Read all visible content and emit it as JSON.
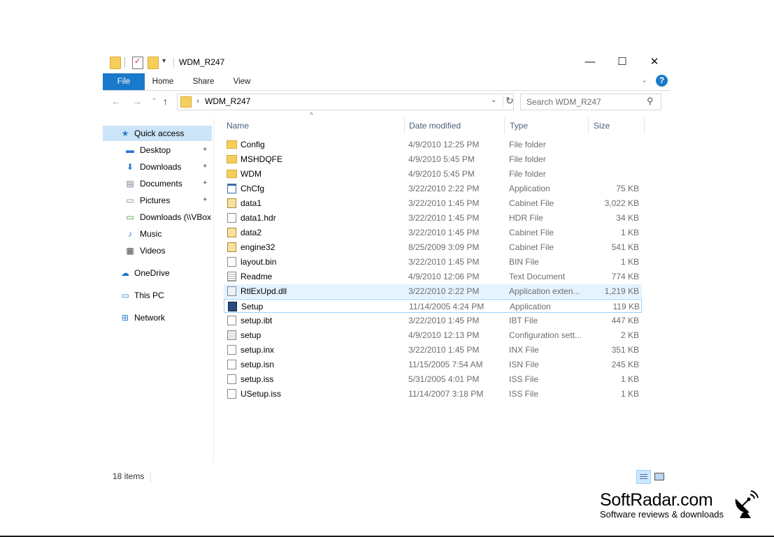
{
  "window": {
    "title": "WDM_R247",
    "controls": {
      "minimize": "—",
      "maximize": "☐",
      "close": "✕"
    }
  },
  "ribbon": {
    "tabs": [
      "File",
      "Home",
      "Share",
      "View"
    ],
    "expand_icon": "chevron-down",
    "help": "?"
  },
  "navbar": {
    "back": "←",
    "forward": "→",
    "recent": "⌄",
    "up": "↑",
    "address": {
      "chevron": "›",
      "path": "WDM_R247",
      "dropdown": "⌄",
      "refresh": "↻"
    },
    "search": {
      "placeholder": "Search WDM_R247",
      "icon": "⚲"
    }
  },
  "sidebar": {
    "items": [
      {
        "label": "Quick access",
        "icon": "★",
        "color": "#2b79d0"
      },
      {
        "label": "Desktop",
        "icon": "▬",
        "color": "#2b79d0",
        "pinned": true
      },
      {
        "label": "Downloads",
        "icon": "⬇",
        "color": "#2b79d0",
        "pinned": true
      },
      {
        "label": "Documents",
        "icon": "▤",
        "color": "#6d7f95",
        "pinned": true
      },
      {
        "label": "Pictures",
        "icon": "▭",
        "color": "#6d7f95",
        "pinned": true
      },
      {
        "label": "Downloads (\\\\VBox",
        "icon": "▭",
        "color": "#4a8a3a"
      },
      {
        "label": "Music",
        "icon": "♪",
        "color": "#2b79d0"
      },
      {
        "label": "Videos",
        "icon": "▦",
        "color": "#444444"
      },
      {
        "label": "OneDrive",
        "icon": "☁",
        "color": "#1d6fd0"
      },
      {
        "label": "This PC",
        "icon": "▭",
        "color": "#2b79d0"
      },
      {
        "label": "Network",
        "icon": "⊞",
        "color": "#2b79d0"
      }
    ],
    "pin_icon": "📌"
  },
  "columns": {
    "name": "Name",
    "date": "Date modified",
    "type": "Type",
    "size": "Size",
    "sort_indicator": "^"
  },
  "files": [
    {
      "name": "Config",
      "date": "4/9/2010 12:25 PM",
      "type": "File folder",
      "size": "",
      "icon": "folder"
    },
    {
      "name": "MSHDQFE",
      "date": "4/9/2010 5:45 PM",
      "type": "File folder",
      "size": "",
      "icon": "folder"
    },
    {
      "name": "WDM",
      "date": "4/9/2010 5:45 PM",
      "type": "File folder",
      "size": "",
      "icon": "folder"
    },
    {
      "name": "ChCfg",
      "date": "3/22/2010 2:22 PM",
      "type": "Application",
      "size": "75 KB",
      "icon": "app"
    },
    {
      "name": "data1",
      "date": "3/22/2010 1:45 PM",
      "type": "Cabinet File",
      "size": "3,022 KB",
      "icon": "cab"
    },
    {
      "name": "data1.hdr",
      "date": "3/22/2010 1:45 PM",
      "type": "HDR File",
      "size": "34 KB",
      "icon": "doc"
    },
    {
      "name": "data2",
      "date": "3/22/2010 1:45 PM",
      "type": "Cabinet File",
      "size": "1 KB",
      "icon": "cab"
    },
    {
      "name": "engine32",
      "date": "8/25/2009 3:09 PM",
      "type": "Cabinet File",
      "size": "541 KB",
      "icon": "cab"
    },
    {
      "name": "layout.bin",
      "date": "3/22/2010 1:45 PM",
      "type": "BIN File",
      "size": "1 KB",
      "icon": "doc"
    },
    {
      "name": "Readme",
      "date": "4/9/2010 12:06 PM",
      "type": "Text Document",
      "size": "774 KB",
      "icon": "text"
    },
    {
      "name": "RtlExUpd.dll",
      "date": "3/22/2010 2:22 PM",
      "type": "Application exten...",
      "size": "1,219 KB",
      "icon": "dll"
    },
    {
      "name": "Setup",
      "date": "11/14/2005 4:24 PM",
      "type": "Application",
      "size": "119 KB",
      "icon": "setup"
    },
    {
      "name": "setup.ibt",
      "date": "3/22/2010 1:45 PM",
      "type": "IBT File",
      "size": "447 KB",
      "icon": "doc"
    },
    {
      "name": "setup",
      "date": "4/9/2010 12:13 PM",
      "type": "Configuration sett...",
      "size": "2 KB",
      "icon": "cfg"
    },
    {
      "name": "setup.inx",
      "date": "3/22/2010 1:45 PM",
      "type": "INX File",
      "size": "351 KB",
      "icon": "doc"
    },
    {
      "name": "setup.isn",
      "date": "11/15/2005 7:54 AM",
      "type": "ISN File",
      "size": "245 KB",
      "icon": "doc"
    },
    {
      "name": "setup.iss",
      "date": "5/31/2005 4:01 PM",
      "type": "ISS File",
      "size": "1 KB",
      "icon": "doc"
    },
    {
      "name": "USetup.iss",
      "date": "11/14/2007 3:18 PM",
      "type": "ISS File",
      "size": "1 KB",
      "icon": "doc"
    }
  ],
  "hovered_row": 10,
  "focused_row": 11,
  "status": {
    "items": "18 items"
  },
  "watermark": {
    "title": "SoftRadar.com",
    "subtitle": "Software reviews & downloads"
  }
}
